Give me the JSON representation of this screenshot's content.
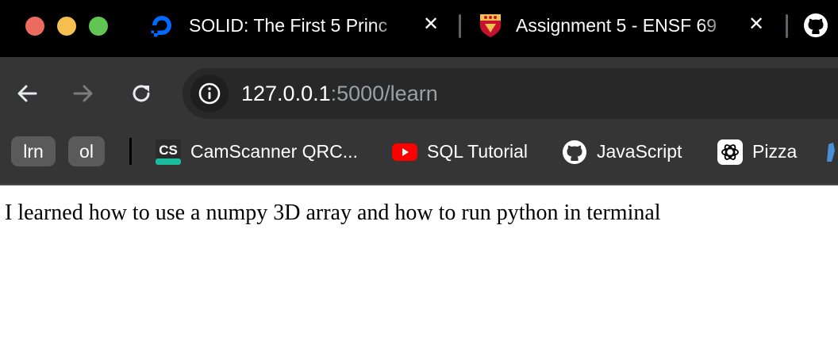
{
  "tabs": [
    {
      "title": "SOLID: The First 5 Princ",
      "icon": "digitalocean-icon"
    },
    {
      "title": "Assignment 5 - ENSF 69",
      "icon": "university-crest-icon"
    },
    {
      "title": "",
      "icon": "github-icon"
    }
  ],
  "tab_close_glyph": "✕",
  "toolbar": {
    "back_icon": "back-arrow-icon",
    "forward_icon": "forward-arrow-icon",
    "reload_icon": "reload-icon",
    "url_host": "127.0.0.1",
    "url_rest": ":5000/learn"
  },
  "bookmarks": {
    "pills": [
      "lrn",
      "ol"
    ],
    "items": [
      {
        "label": "CamScanner QRC...",
        "icon": "camscanner-icon"
      },
      {
        "label": "SQL Tutorial",
        "icon": "youtube-icon"
      },
      {
        "label": "JavaScript",
        "icon": "github-icon"
      },
      {
        "label": "Pizza",
        "icon": "openai-icon"
      }
    ]
  },
  "page": {
    "text": "I learned how to use a numpy 3D array and how to run python in terminal"
  },
  "colors": {
    "traffic_red": "#ed6a5e",
    "traffic_yellow": "#f4bf4f",
    "traffic_green": "#61c554",
    "toolbar_bg": "#353535",
    "tabstrip_bg": "#000000",
    "digitalocean_blue": "#0069ff",
    "youtube_red": "#ff0000"
  }
}
